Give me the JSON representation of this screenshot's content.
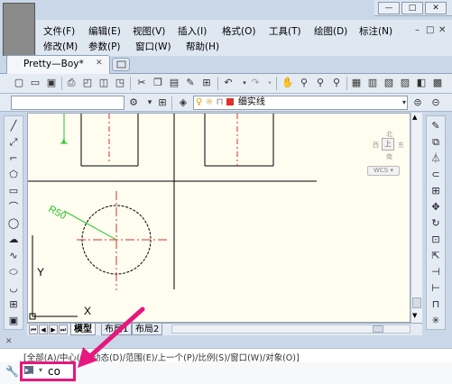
{
  "window": {
    "controls": [
      "—",
      "□",
      "✕"
    ]
  },
  "menus": {
    "row1": [
      "文件(F)",
      "编辑(E)",
      "视图(V)",
      "插入(I)",
      "格式(O)",
      "工具(T)",
      "绘图(D)",
      "标注(N)"
    ],
    "row2": [
      "修改(M)",
      "参数(P)",
      "窗口(W)",
      "帮助(H)"
    ],
    "doc_controls": [
      "–",
      "□",
      "✕"
    ]
  },
  "document_tab": {
    "title": "Pretty—Boy*",
    "close": "✕"
  },
  "toolbar": {
    "layer_combo": "",
    "lineweight_combo": "细实线"
  },
  "viewcube": {
    "face": "上",
    "north": "北",
    "south": "南",
    "west": "西",
    "east": "东",
    "wcs": "WCS"
  },
  "drawing": {
    "dimension_text": "R50",
    "ucs_x": "X",
    "ucs_y": "Y"
  },
  "layout_tabs": [
    "模型",
    "布局1",
    "布局2"
  ],
  "command": {
    "history": "[全部(A)/中心(C)/动态(D)/范围(E)/上一个(P)/比例(S)/窗口(W)/对象(O)]",
    "prompt_icon": "▸_",
    "input_value": "co"
  },
  "colors": {
    "canvas_bg": "#fffdf0",
    "highlight": "#e6177d",
    "dimension": "#29c329",
    "centerline": "#e0302a"
  }
}
